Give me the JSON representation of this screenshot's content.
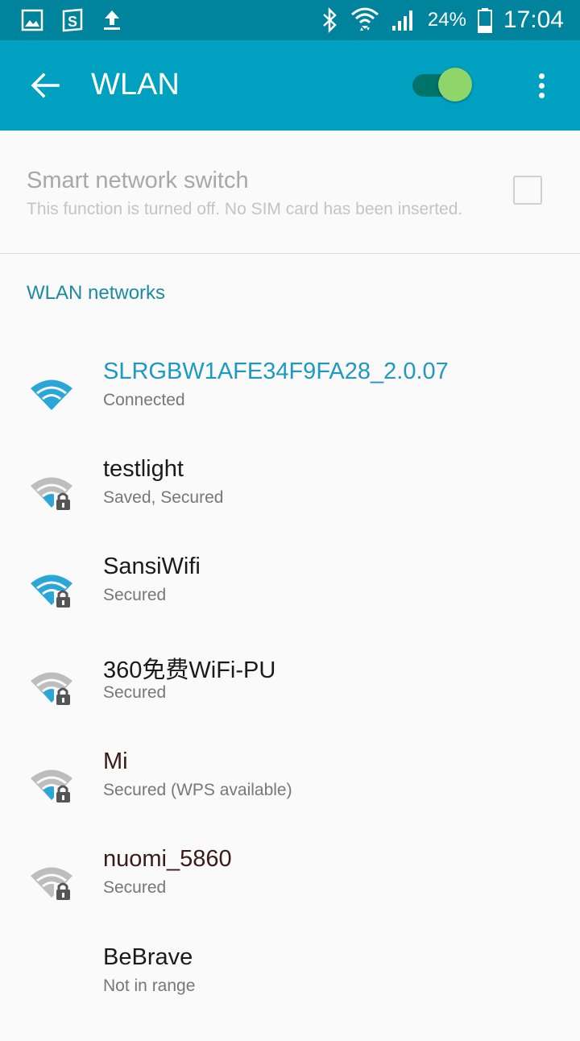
{
  "status_bar": {
    "battery_percent": "24%",
    "clock": "17:04",
    "icons_left": [
      "gallery-icon",
      "s-app-icon",
      "upload-icon"
    ],
    "icons_right": [
      "bluetooth-icon",
      "wifi-signal-icon",
      "cell-signal-icon",
      "battery-icon"
    ]
  },
  "app_bar": {
    "title": "WLAN",
    "back_icon": "arrow-left-icon",
    "wlan_toggle_on": true,
    "overflow_icon": "more-vert-icon"
  },
  "smart_switch": {
    "title": "Smart network switch",
    "subtitle": "This function is turned off. No SIM card has been inserted.",
    "checked": false
  },
  "section": {
    "header": "WLAN networks"
  },
  "networks": [
    {
      "name": "SLRGBW1AFE34F9FA28_2.0.07",
      "status": "Connected",
      "signal": "full",
      "secured": false,
      "connected": true
    },
    {
      "name": "testlight",
      "status": "Saved, Secured",
      "signal": "weak",
      "secured": true,
      "connected": false
    },
    {
      "name": "SansiWifi",
      "status": "Secured",
      "signal": "full",
      "secured": true,
      "connected": false
    },
    {
      "name": "360免费WiFi-PU",
      "status": "Secured",
      "signal": "weak",
      "secured": true,
      "connected": false
    },
    {
      "name": "Mi",
      "status": "Secured (WPS available)",
      "signal": "weak",
      "secured": true,
      "connected": false
    },
    {
      "name": "nuomi_5860",
      "status": "Secured",
      "signal": "weak",
      "secured": true,
      "connected": false
    },
    {
      "name": "BeBrave",
      "status": "Not in range",
      "signal": "none",
      "secured": false,
      "connected": false
    }
  ],
  "colors": {
    "status_bar": "#00839c",
    "app_bar": "#00a0c0",
    "accent": "#1f98c2",
    "wifi_active": "#2aa6d8",
    "wifi_inactive": "#bdbdbd"
  }
}
